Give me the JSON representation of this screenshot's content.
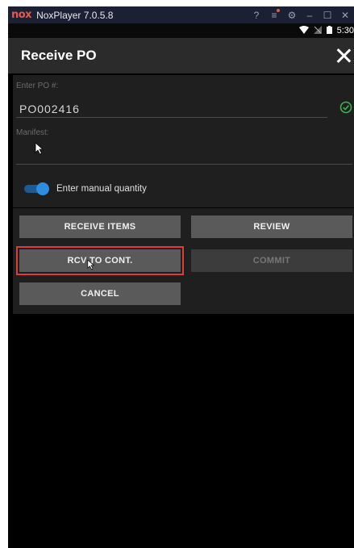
{
  "window": {
    "logo": "nox",
    "title": "NoxPlayer 7.0.5.8",
    "controls": [
      "?",
      "≡",
      "⚙",
      "–",
      "☐",
      "✕"
    ]
  },
  "status_bar": {
    "time": "5:30"
  },
  "header": {
    "title": "Receive PO"
  },
  "form": {
    "po_label": "Enter PO #:",
    "po_value": "PO002416",
    "manifest_label": "Manifest:",
    "manifest_value": "",
    "toggle_label": "Enter manual quantity",
    "toggle_on": true
  },
  "buttons": {
    "receive_items": "RECEIVE ITEMS",
    "review": "REVIEW",
    "rcv_to_cont": "RCV TO CONT.",
    "commit": "COMMIT",
    "cancel": "CANCEL"
  },
  "colors": {
    "accent": "#2e8de0",
    "valid_check": "#3bb54a",
    "highlight_box": "#e03a3a"
  }
}
